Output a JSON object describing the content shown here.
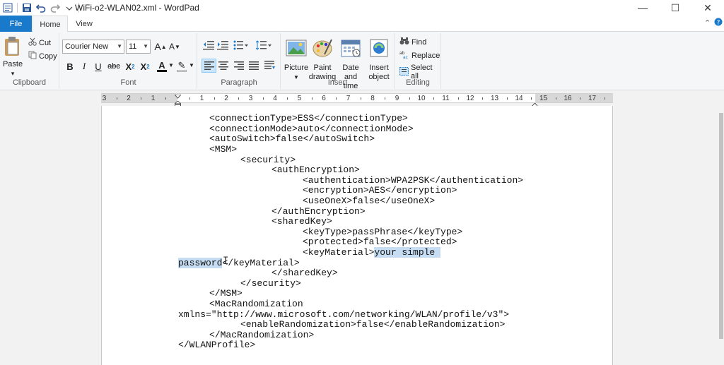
{
  "window": {
    "title": "WiFi-o2-WLAN02.xml - WordPad",
    "minimize": "—",
    "maximize": "☐",
    "close": "✕"
  },
  "tabs": {
    "file": "File",
    "home": "Home",
    "view": "View"
  },
  "ribbon": {
    "clipboard": {
      "label": "Clipboard",
      "paste": "Paste",
      "paste_arrow": "▾",
      "cut": "Cut",
      "copy": "Copy"
    },
    "font": {
      "label": "Font",
      "family": "Courier New",
      "size": "11",
      "grow": "A",
      "shrink": "A",
      "bold": "B",
      "italic": "I",
      "underline": "U",
      "strikethrough": "abc",
      "subscript": "X",
      "superscript": "X",
      "subscript_mark": "2",
      "superscript_mark": "2",
      "text_color": "A",
      "highlight": "✎"
    },
    "paragraph": {
      "label": "Paragraph"
    },
    "insert": {
      "label": "Insert",
      "picture": "Picture",
      "paint_drawing_1": "Paint",
      "paint_drawing_2": "drawing",
      "date_time_1": "Date and",
      "date_time_2": "time",
      "insert_object_1": "Insert",
      "insert_object_2": "object"
    },
    "editing": {
      "label": "Editing",
      "find": "Find",
      "replace": "Replace",
      "select_all": "Select all"
    }
  },
  "ruler": {
    "numbers": [
      "3",
      "2",
      "1",
      "1",
      "2",
      "3",
      "4",
      "5",
      "6",
      "7",
      "8",
      "9",
      "10",
      "11",
      "12",
      "13",
      "14",
      "15",
      "16",
      "17"
    ]
  },
  "document": {
    "lines": [
      "<connectionType>ESS</connectionType>",
      "<connectionMode>auto</connectionMode>",
      "<autoSwitch>false</autoSwitch>",
      "<MSM>",
      "<security>",
      "<authEncryption>",
      "<authentication>WPA2PSK</authentication>",
      "<encryption>AES</encryption>",
      "<useOneX>false</useOneX>",
      "</authEncryption>",
      "<sharedKey>",
      "<keyType>passPhrase</keyType>",
      "<protected>false</protected>",
      "<keyMaterial>",
      "your simple ",
      "password",
      "</keyMaterial>",
      "</sharedKey>",
      "</security>",
      "</MSM>",
      "<MacRandomization",
      "xmlns=\"http://www.microsoft.com/networking/WLAN/profile/v3\">",
      "<enableRandomization>false</enableRandomization>",
      "</MacRandomization>",
      "</WLANProfile>"
    ]
  },
  "colors": {
    "file_tab": "#1979ca",
    "selection": "#c5dcf3",
    "ribbon_bg": "#f5f6f7"
  }
}
